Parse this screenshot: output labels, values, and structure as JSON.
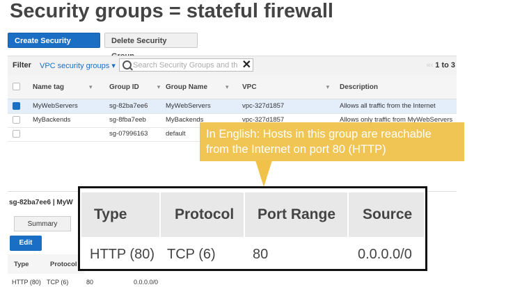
{
  "slide_title": "Security groups = stateful firewall",
  "toolbar": {
    "create_label": "Create Security Group",
    "delete_label": "Delete Security Group"
  },
  "filter": {
    "label": "Filter",
    "select_value": "VPC security groups",
    "search_placeholder": "Search Security Groups and th",
    "pager": "1 to 3"
  },
  "table": {
    "headers": [
      "Name tag",
      "Group ID",
      "Group Name",
      "VPC",
      "Description"
    ],
    "rows": [
      {
        "name_tag": "MyWebServers",
        "group_id": "sg-82ba7ee6",
        "group_name": "MyWebServers",
        "vpc": "vpc-327d1857",
        "description": "Allows all traffic from the Internet",
        "selected": true
      },
      {
        "name_tag": "MyBackends",
        "group_id": "sg-8fba7eeb",
        "group_name": "MyBackends",
        "vpc": "vpc-327d1857",
        "description": "Allows only traffic from MyWebServers",
        "selected": false
      },
      {
        "name_tag": "",
        "group_id": "sg-07996163",
        "group_name": "default",
        "vpc": "",
        "description": "",
        "selected": false
      }
    ]
  },
  "detail": {
    "id_label": "sg-82ba7ee6 | MyW",
    "tab_summary": "Summary",
    "edit_label": "Edit",
    "headers": [
      "Type",
      "Protocol"
    ],
    "row": {
      "type": "HTTP (80)",
      "protocol": "TCP (6)",
      "port": "80",
      "source": "0.0.0.0/0"
    }
  },
  "callout": {
    "line1": "In English: Hosts in this group are reachable",
    "line2": "from the Internet on port 80 (HTTP)"
  },
  "zoom": {
    "headers": [
      "Type",
      "Protocol",
      "Port Range",
      "Source"
    ],
    "values": [
      "HTTP (80)",
      "TCP (6)",
      "80",
      "0.0.0.0/0"
    ]
  },
  "colors": {
    "accent": "#1a6fc4",
    "callout": "#f0c24a"
  }
}
